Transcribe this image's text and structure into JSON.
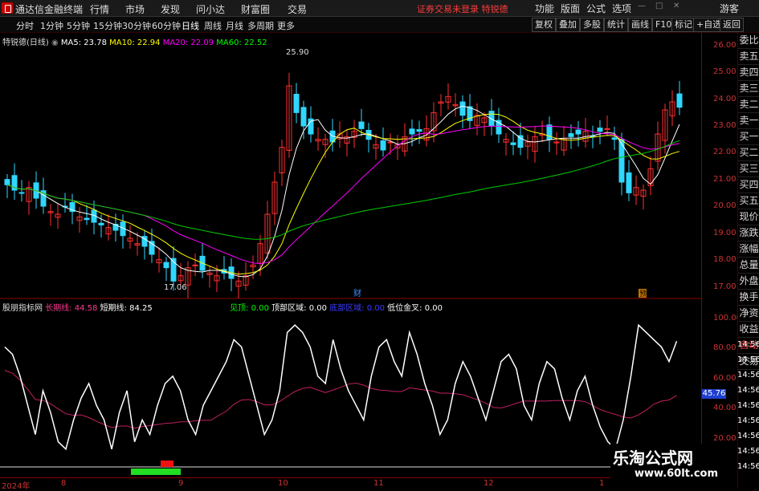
{
  "app": {
    "title": "通达信金融终端",
    "menus": [
      "行情",
      "市场",
      "发现",
      "问小达",
      "财富圈",
      "交易"
    ],
    "warning": "证券交易未登录 特锐德",
    "right_buttons": [
      "功能",
      "版面",
      "公式",
      "选项",
      "游客"
    ]
  },
  "periods": {
    "items": [
      "分时",
      "1分钟",
      "5分钟",
      "15分钟",
      "30分钟",
      "60分钟",
      "日线",
      "周线",
      "月线",
      "多周期",
      "更多"
    ],
    "active": "日线"
  },
  "tools": [
    "复权",
    "叠加",
    "多股",
    "统计",
    "画线",
    "F10",
    "标记",
    "+自选",
    "返回"
  ],
  "main": {
    "stock_label": "特锐德(日线)",
    "ma": [
      {
        "label": "MA5: 23.78",
        "color": "#ffffff"
      },
      {
        "label": "MA10: 22.94",
        "color": "#ffff00"
      },
      {
        "label": "MA20: 22.09",
        "color": "#ff00ff"
      },
      {
        "label": "MA60: 22.52",
        "color": "#00ff00"
      }
    ],
    "high_label": "25.90",
    "low_label": "17.06",
    "marker_cai": "财",
    "marker_yu": "预",
    "y_ticks": [
      "26.00",
      "25.00",
      "24.00",
      "23.00",
      "22.00",
      "21.00",
      "20.00",
      "19.00",
      "18.00",
      "17.00"
    ]
  },
  "indicator": {
    "name": "股朋指标网",
    "fields": [
      {
        "label": "长期线: 44.58",
        "color": "#ff3b8f"
      },
      {
        "label": "短期线: 84.25",
        "color": "#ffffff"
      },
      {
        "label": "见顶: 0.00",
        "color": "#00ff00"
      },
      {
        "label": "顶部区域: 0.00",
        "color": "#ffffff"
      },
      {
        "label": "底部区域: 0.00",
        "color": "#3b3bff"
      },
      {
        "label": "低位金叉: 0.00",
        "color": "#ffffff"
      }
    ],
    "y_ticks": [
      "100.00",
      "80.00",
      "60.00",
      "40.00",
      "20.00"
    ],
    "latest_value": "45.76"
  },
  "xaxis": [
    "2024年",
    "8",
    "9",
    "10",
    "11",
    "12",
    "1"
  ],
  "side_panel": {
    "items": [
      "委比",
      "卖五",
      "卖四",
      "卖三",
      "卖二",
      "卖一",
      "买一",
      "买二",
      "买三",
      "买四",
      "买五",
      "现价",
      "涨跌",
      "涨幅",
      "总量",
      "外盘",
      "换手",
      "净资",
      "收益"
    ],
    "auto_trade": "自动",
    "trade": "交易",
    "times": [
      "14:56",
      "14:56",
      "14:56",
      "14:56",
      "14:56",
      "14:56",
      "14:56",
      "14:56",
      "14:56"
    ]
  },
  "watermark": {
    "line1": "乐淘公式网",
    "line2": "www.60lt.com"
  },
  "chart_data": {
    "type": "line",
    "title": "",
    "ylim": [
      16.8,
      26.4
    ],
    "x": [
      "2024年",
      "8",
      "9",
      "10",
      "11",
      "12",
      "1"
    ],
    "close": [
      20.9,
      20.7,
      20.6,
      20.8,
      20.4,
      20.1,
      19.9,
      19.8,
      20.1,
      19.9,
      19.7,
      19.6,
      19.5,
      19.4,
      19.3,
      19.2,
      19.0,
      18.9,
      18.7,
      18.6,
      18.3,
      18.1,
      17.8,
      17.3,
      17.5,
      17.8,
      17.9,
      17.7,
      17.6,
      17.5,
      17.6,
      17.4,
      17.3,
      17.5,
      17.9,
      18.7,
      19.8,
      21.0,
      22.3,
      24.6,
      23.6,
      23.1,
      22.8,
      22.6,
      22.6,
      22.5,
      22.8,
      22.7,
      22.9,
      23.0,
      22.6,
      22.4,
      22.2,
      22.5,
      22.4,
      22.7,
      22.8,
      22.9,
      23.0,
      23.6,
      24.0,
      24.2,
      23.9,
      23.5,
      23.3,
      23.5,
      23.4,
      23.1,
      22.8,
      22.6,
      22.4,
      22.3,
      22.5,
      22.7,
      22.8,
      22.6,
      22.5,
      22.6,
      22.7,
      22.8,
      22.9,
      22.7,
      22.9,
      23.0,
      22.6,
      21.0,
      20.6,
      20.8,
      20.7,
      21.5,
      22.8,
      23.7,
      24.0,
      23.8
    ],
    "series": [
      {
        "name": "MA5",
        "last": 23.78
      },
      {
        "name": "MA10",
        "last": 22.94
      },
      {
        "name": "MA20",
        "last": 22.09
      },
      {
        "name": "MA60",
        "last": 22.52
      }
    ]
  }
}
